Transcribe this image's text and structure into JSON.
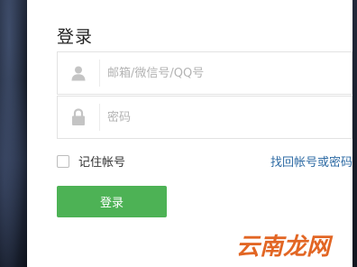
{
  "login": {
    "title": "登录",
    "username_placeholder": "邮箱/微信号/QQ号",
    "username_value": "",
    "password_placeholder": "密码",
    "password_value": "",
    "remember_label": "记住帐号",
    "remember_checked": false,
    "forgot_link": "找回帐号或密码",
    "submit_label": "登录",
    "submit_color": "#4db255",
    "link_color": "#2e6ba4"
  },
  "icons": {
    "user": "user-icon",
    "lock": "lock-icon"
  },
  "watermark": {
    "text": "云南龙网",
    "color": "#e05a12"
  }
}
